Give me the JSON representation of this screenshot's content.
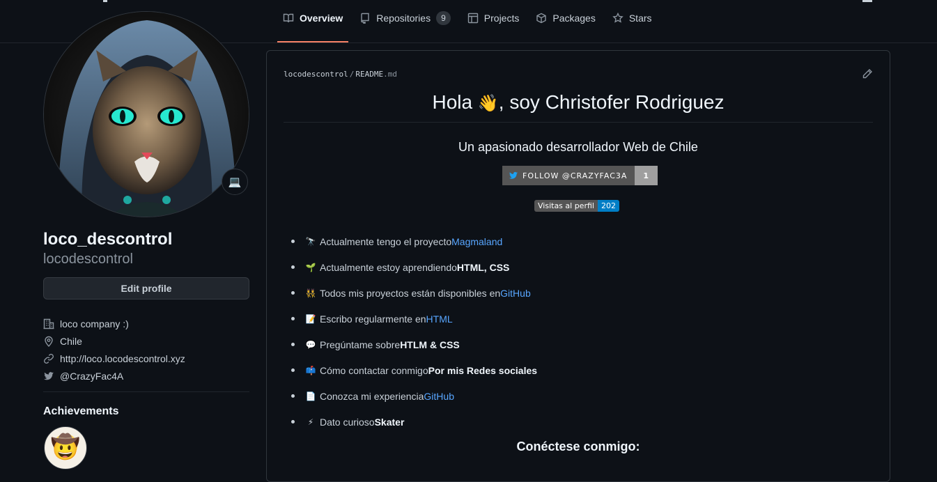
{
  "tabs": [
    {
      "label": "Overview",
      "active": true,
      "icon": "book-icon"
    },
    {
      "label": "Repositories",
      "count": "9",
      "icon": "repo-icon"
    },
    {
      "label": "Projects",
      "icon": "table-icon"
    },
    {
      "label": "Packages",
      "icon": "package-icon"
    },
    {
      "label": "Stars",
      "icon": "star-icon"
    }
  ],
  "profile": {
    "name": "loco_descontrol",
    "login": "locodescontrol",
    "status_emoji": "💻",
    "edit_label": "Edit profile",
    "company": "loco company :)",
    "location": "Chile",
    "website": "http://loco.locodescontrol.xyz",
    "twitter": "@CrazyFac4A",
    "achievements_title": "Achievements",
    "achievement_emoji": "🤠"
  },
  "readme": {
    "owner": "locodescontrol",
    "sep": "/",
    "file": "README",
    "ext": ".md",
    "title_pre": "Hola ",
    "title_emoji": "👋",
    "title_post": ", soy Christofer Rodriguez",
    "subtitle": "Un apasionado desarrollador Web de Chile",
    "follow_label": "FOLLOW @CRAZYFAC3A",
    "follow_count": "1",
    "visits_label": "Visitas al perfil",
    "visits_count": "202",
    "items": [
      {
        "emoji": "🔭",
        "text": "Actualmente tengo el proyecto ",
        "link": "Magmaland"
      },
      {
        "emoji": "🌱",
        "text": "Actualmente estoy aprendiendo ",
        "bold": "HTML, CSS"
      },
      {
        "emoji": "👯",
        "text": "Todos mis proyectos están disponibles en ",
        "link": "GitHub"
      },
      {
        "emoji": "📝",
        "text": "Escribo regularmente en ",
        "link": "HTML"
      },
      {
        "emoji": "💬",
        "text": "Pregúntame sobre ",
        "bold": "HTLM & CSS"
      },
      {
        "emoji": "📫",
        "text": "Cómo contactar conmigo ",
        "bold": "Por mis Redes sociales"
      },
      {
        "emoji": "📄",
        "text": "Conozca mi experiencia ",
        "link": "GitHub"
      },
      {
        "emoji": "⚡",
        "text": "Dato curioso ",
        "bold": "Skater"
      }
    ],
    "connect": "Conéctese conmigo:"
  },
  "colors": {
    "accent": "#f78166",
    "link": "#58a6ff",
    "bg": "#0d1117"
  }
}
